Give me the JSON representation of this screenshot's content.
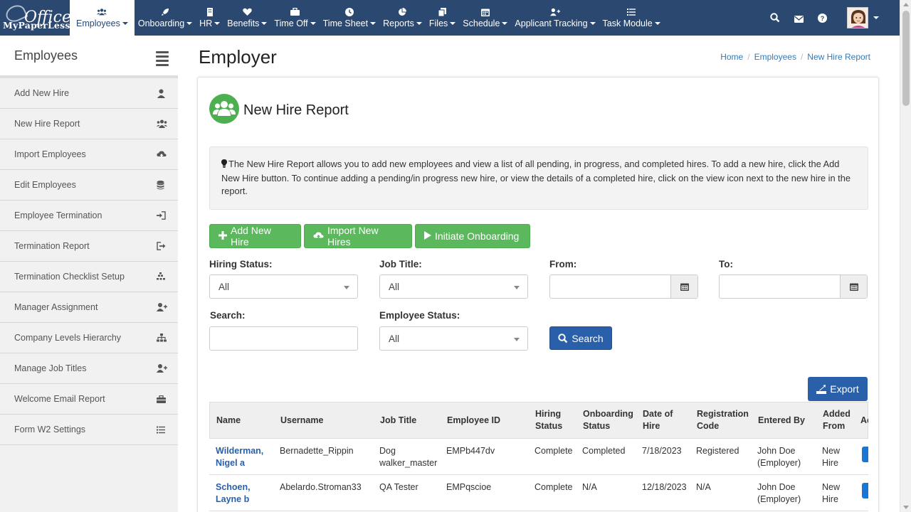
{
  "brand": {
    "top": "Office",
    "bottom": "MyPaperLess"
  },
  "nav": {
    "items": [
      {
        "label": "Employees",
        "icon": "users-icon",
        "active": true
      },
      {
        "label": "Onboarding",
        "icon": "rocket-icon"
      },
      {
        "label": "HR",
        "icon": "building-icon"
      },
      {
        "label": "Benefits",
        "icon": "heart-icon"
      },
      {
        "label": "Time Off",
        "icon": "briefcase-icon"
      },
      {
        "label": "Time Sheet",
        "icon": "clock-icon"
      },
      {
        "label": "Reports",
        "icon": "pie-chart-icon"
      },
      {
        "label": "Files",
        "icon": "files-icon"
      },
      {
        "label": "Schedule",
        "icon": "calendar-icon"
      },
      {
        "label": "Applicant Tracking",
        "icon": "user-plus-icon"
      },
      {
        "label": "Task Module",
        "icon": "tasks-icon"
      }
    ],
    "right_icons": [
      "search-icon",
      "envelope-icon",
      "help-icon"
    ]
  },
  "sidebar": {
    "title": "Employees",
    "items": [
      {
        "label": "Add New Hire",
        "icon": "user-icon"
      },
      {
        "label": "New Hire Report",
        "icon": "users-icon"
      },
      {
        "label": "Import Employees",
        "icon": "cloud-upload-icon"
      },
      {
        "label": "Edit Employees",
        "icon": "database-icon"
      },
      {
        "label": "Employee Termination",
        "icon": "sign-in-icon"
      },
      {
        "label": "Termination Report",
        "icon": "sign-out-icon"
      },
      {
        "label": "Termination Checklist Setup",
        "icon": "checklist-icon"
      },
      {
        "label": "Manager Assignment",
        "icon": "user-plus-icon"
      },
      {
        "label": "Company Levels Hierarchy",
        "icon": "sitemap-icon"
      },
      {
        "label": "Manage Job Titles",
        "icon": "user-plus-icon"
      },
      {
        "label": "Welcome Email Report",
        "icon": "briefcase-icon"
      },
      {
        "label": "Form W2 Settings",
        "icon": "list-icon"
      }
    ]
  },
  "page": {
    "title": "Employer",
    "breadcrumb": [
      "Home",
      "Employees",
      "New Hire Report"
    ]
  },
  "report": {
    "title": "New Hire Report",
    "info": "The New Hire Report allows you to add new employees and view a list of all pending, in progress, and completed hires. To add a new hire, click the Add New Hire button. To continue adding a pending/in progress new hire, or view the details of a completed hire, click on the view icon next to the new hire in the report.",
    "buttons": {
      "add": "Add New Hire",
      "import": "Import New Hires",
      "initiate": "Initiate Onboarding",
      "search": "Search",
      "export": "Export"
    },
    "filters": {
      "hiring_status_label": "Hiring Status:",
      "hiring_status_value": "All",
      "job_title_label": "Job Title:",
      "job_title_value": "All",
      "from_label": "From:",
      "from_value": "",
      "to_label": "To:",
      "to_value": "",
      "search_label": "Search:",
      "search_value": "",
      "employee_status_label": "Employee Status:",
      "employee_status_value": "All"
    },
    "columns": [
      "Name",
      "Username",
      "Job Title",
      "Employee ID",
      "Hiring Status",
      "Onboarding Status",
      "Date of Hire",
      "Registration Code",
      "Entered By",
      "Added From",
      "Ac"
    ],
    "rows": [
      {
        "name": "Wilderman, Nigel a",
        "username": "Bernadette_Rippin",
        "job_title": "Dog walker_master",
        "employee_id": "EMPb447dv",
        "hiring_status": "Complete",
        "onboarding_status": "Completed",
        "date_of_hire": "7/18/2023",
        "registration_code": "Registered",
        "entered_by": "John Doe (Employer)",
        "added_from": "New Hire"
      },
      {
        "name": "Schoen, Layne b",
        "username": "Abelardo.Stroman33",
        "job_title": "QA Tester",
        "employee_id": "EMPqscioe",
        "hiring_status": "Complete",
        "onboarding_status": "N/A",
        "date_of_hire": "12/18/2023",
        "registration_code": "N/A",
        "entered_by": "John Doe (Employer)",
        "added_from": "New Hire"
      }
    ]
  },
  "colors": {
    "nav": "#2a4870",
    "green": "#5cb85c",
    "blue": "#2a5faa"
  }
}
